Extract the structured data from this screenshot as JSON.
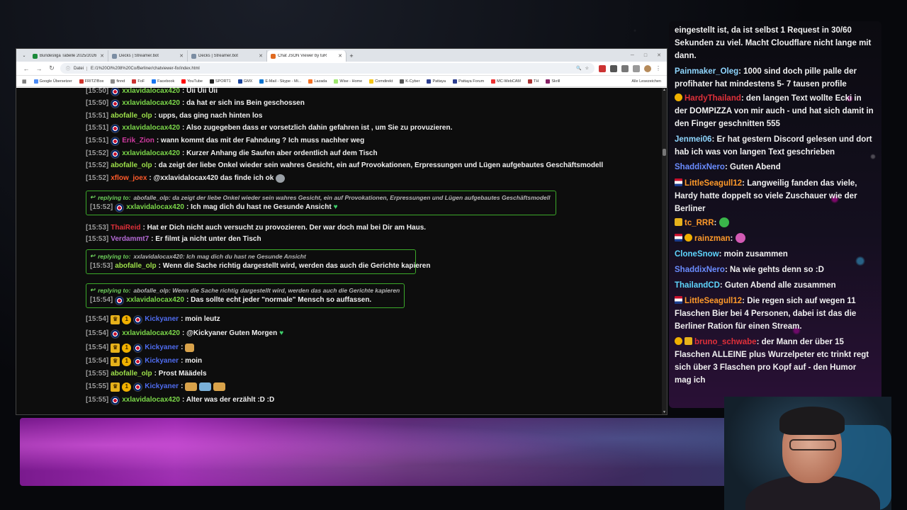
{
  "browser": {
    "tabs": [
      {
        "label": "Bundesliga Tabelle 2025/2026 |",
        "active": false
      },
      {
        "label": "Decks | Streamer.bot",
        "active": false
      },
      {
        "label": "Decks | Streamer.bot",
        "active": false
      },
      {
        "label": "Chat JSON Viewer by tuR",
        "active": true
      }
    ],
    "new_tab_label": "+",
    "address": {
      "chip": "Datei",
      "url": "E:/1%20OI%208%20Co/Berliner/chatviewer-fix/index.html"
    },
    "bookmarks": [
      {
        "label": "Google Übersetzer",
        "color": "#4a8af4"
      },
      {
        "label": "FRITZ!Box",
        "color": "#d0342c"
      },
      {
        "label": "finnd",
        "color": "#8a8a8a"
      },
      {
        "label": "FoF",
        "color": "#c33"
      },
      {
        "label": "Facebook",
        "color": "#1877f2"
      },
      {
        "label": "YouTube",
        "color": "#ff0000"
      },
      {
        "label": "SPORT1",
        "color": "#222"
      },
      {
        "label": "GMX",
        "color": "#1c449b"
      },
      {
        "label": "E-Mail - Skype - Mi...",
        "color": "#0a74d0"
      },
      {
        "label": "Lazada",
        "color": "#f57224"
      },
      {
        "label": "Wise - Home",
        "color": "#9fe870"
      },
      {
        "label": "Comdirekt",
        "color": "#f5c518"
      },
      {
        "label": "K-Cyber",
        "color": "#555"
      },
      {
        "label": "Pattaya",
        "color": "#2c3e90"
      },
      {
        "label": "Pattaya Forum",
        "color": "#2c3e90"
      },
      {
        "label": "MC-WebCAM",
        "color": "#e33"
      },
      {
        "label": "TH",
        "color": "#a33"
      },
      {
        "label": "Skrill",
        "color": "#862165"
      }
    ],
    "bookmarks_more": "Alle Lesezeichen"
  },
  "chat": {
    "lines": [
      {
        "ts": "[15:50]",
        "user": "xxlavidalocax420",
        "ucolor": "#7cd94a",
        "badges": [
          "uk"
        ],
        "msg": ": Uii Uii Uii"
      },
      {
        "ts": "[15:50]",
        "user": "xxlavidalocax420",
        "ucolor": "#7cd94a",
        "badges": [
          "uk"
        ],
        "msg": ": da hat er sich ins Bein geschossen"
      },
      {
        "ts": "[15:51]",
        "user": "abofalle_olp",
        "ucolor": "#9de04a",
        "badges": [],
        "msg": ": upps, das ging nach hinten los"
      },
      {
        "ts": "[15:51]",
        "user": "xxlavidalocax420",
        "ucolor": "#7cd94a",
        "badges": [
          "uk"
        ],
        "msg": ": Also zugegeben dass er vorsetzlich dahin gefahren ist , um Sie zu provuzieren."
      },
      {
        "ts": "[15:51]",
        "user": "Erik_Zion",
        "ucolor": "#d13ba1",
        "badges": [
          "uk"
        ],
        "msg": ": wann kommt das mit der Fahndung ? Ich muss nachher weg"
      },
      {
        "ts": "[15:52]",
        "user": "xxlavidalocax420",
        "ucolor": "#7cd94a",
        "badges": [
          "uk"
        ],
        "msg": ": Kurzer Anhang die Saufen aber ordentlich auf dem Tisch"
      },
      {
        "ts": "[15:52]",
        "user": "abofalle_olp",
        "ucolor": "#9de04a",
        "badges": [],
        "msg": ": da zeigt der liebe Onkel wieder sein wahres Gesicht, ein auf Provokationen, Erpressungen und Lügen aufgebautes Geschäftsmodell"
      },
      {
        "ts": "[15:52]",
        "user": "xflow_joex",
        "ucolor": "#ff5a2a",
        "badges": [],
        "msg": ": @xxlavidalocax420 das finde ich ok"
      }
    ],
    "reply1": {
      "label": "replying to:",
      "ref": "abofalle_olp: da zeigt der liebe Onkel wieder sein wahres Gesicht, ein auf Provokationen, Erpressungen und Lügen aufgebautes Geschäftsmodell",
      "ts": "[15:52]",
      "user": "xxlavidalocax420",
      "msg": ": Ich mag dich du hast ne Gesunde Ansicht"
    },
    "lines2": [
      {
        "ts": "[15:53]",
        "user": "ThaiReid",
        "ucolor": "#e0303a",
        "msg": ": Hat er Dich nicht auch versucht zu provozieren. Der war doch mal bei Dir am Haus."
      },
      {
        "ts": "[15:53]",
        "user": "Verdammt7",
        "ucolor": "#b56bd6",
        "msg": ": Er filmt ja nicht unter den Tisch"
      }
    ],
    "reply2": {
      "label": "replying to:",
      "ref": "xxlavidalocax420: Ich mag dich du hast ne Gesunde Ansicht",
      "ts": "[15:53]",
      "user": "abofalle_olp",
      "msg": ": Wenn die Sache richtig dargestellt wird, werden das auch die Gerichte kapieren"
    },
    "reply3": {
      "label": "replying to:",
      "ref": "abofalle_olp: Wenn die Sache richtig dargestellt wird, werden das auch die Gerichte kapieren",
      "ts": "[15:54]",
      "user": "xxlavidalocax420",
      "msg": ": Das sollte echt jeder \"normale\" Mensch so auffassen."
    },
    "lines3": [
      {
        "ts": "[15:54]",
        "user": "Kickyaner",
        "ucolor": "#4f6cf0",
        "badges": [
          "crown",
          "coin",
          "uk"
        ],
        "msg": ": moin leutz"
      },
      {
        "ts": "[15:54]",
        "user": "xxlavidalocax420",
        "ucolor": "#7cd94a",
        "badges": [
          "uk"
        ],
        "msg": ": @Kickyaner Guten Morgen"
      },
      {
        "ts": "[15:54]",
        "user": "Kickyaner",
        "ucolor": "#4f6cf0",
        "badges": [
          "crown",
          "coin",
          "uk"
        ],
        "msg": ":"
      },
      {
        "ts": "[15:54]",
        "user": "Kickyaner",
        "ucolor": "#4f6cf0",
        "badges": [
          "crown",
          "coin",
          "uk"
        ],
        "msg": ": moin"
      },
      {
        "ts": "[15:55]",
        "user": "abofalle_olp",
        "ucolor": "#9de04a",
        "badges": [],
        "msg": ": Prost Määdels"
      },
      {
        "ts": "[15:55]",
        "user": "Kickyaner",
        "ucolor": "#4f6cf0",
        "badges": [
          "crown",
          "coin",
          "uk"
        ],
        "msg": ":"
      },
      {
        "ts": "[15:55]",
        "user": "xxlavidalocax420",
        "ucolor": "#7cd94a",
        "badges": [
          "uk"
        ],
        "msg": ": Alter was der erzählt :D :D"
      }
    ]
  },
  "right_chat": {
    "lines": [
      {
        "user": "",
        "ucolor": "#ffffff",
        "msg": "eingestellt ist, da ist selbst 1 Request in 30/60 Sekunden zu viel. Macht Cloudflare nicht lange mit dann."
      },
      {
        "user": "Painmaker_Oleg",
        "ucolor": "#8fd6ff",
        "msg": ": 1000 sind doch pille palle der profihater hat mindestens 5- 7 tausen profile"
      },
      {
        "user": "HardyThailand",
        "ucolor": "#e0303a",
        "msg": ": den langen Text wollte Ecki in der DOMPIZZA von mir auch - und hat sich damit in den Finger geschnitten 555"
      },
      {
        "user": "Jenmei06",
        "ucolor": "#8fd6ff",
        "msg": ": Er hat gestern Discord gelesen und dort hab ich was von langen Text geschrieben"
      },
      {
        "user": "ShaddixNero",
        "ucolor": "#6a8cff",
        "msg": ": Guten Abend"
      },
      {
        "user": "LittleSeagull12",
        "ucolor": "#ff9a2a",
        "msg": ": Langweilig fanden das viele, Hardy hatte doppelt so viele Zuschauer wie der Berliner"
      },
      {
        "user": "tc_RRR",
        "ucolor": "#ff9a2a",
        "msg": ":"
      },
      {
        "user": "rainzman",
        "ucolor": "#ff9a2a",
        "msg": ":"
      },
      {
        "user": "CloneSnow",
        "ucolor": "#5fd6ff",
        "msg": ": moin zusammen"
      },
      {
        "user": "ShaddixNero",
        "ucolor": "#6a8cff",
        "msg": ": Na wie gehts denn so :D"
      },
      {
        "user": "ThailandCD",
        "ucolor": "#5fd6ff",
        "msg": ": Guten Abend alle zusammen"
      },
      {
        "user": "LittleSeagull12",
        "ucolor": "#ff9a2a",
        "msg": ": Die regen sich auf wegen 11 Flaschen Bier bei 4 Personen, dabei ist das die Berliner Ration für einen Stream."
      },
      {
        "user": "bruno_schwabe",
        "ucolor": "#e0303a",
        "msg": ": der Mann der über 15 Flaschen ALLEINE plus Wurzelpeter etc trinkt regt sich über 3 Flaschen pro Kopf auf - den Humor mag ich"
      }
    ]
  }
}
